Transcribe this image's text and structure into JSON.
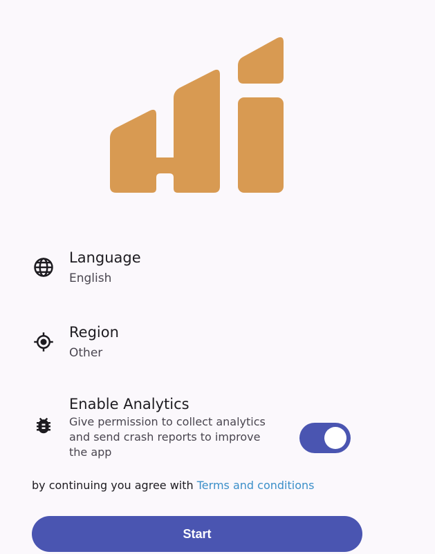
{
  "colors": {
    "background": "#fbf8fc",
    "logo": "#d89a52",
    "accent": "#4a55b1",
    "link": "#3b8fc9"
  },
  "logo": {
    "icon": "hi-logo"
  },
  "settings": {
    "language": {
      "icon": "globe-icon",
      "title": "Language",
      "value": "English"
    },
    "region": {
      "icon": "location-target-icon",
      "title": "Region",
      "value": "Other"
    },
    "analytics": {
      "icon": "bug-icon",
      "title": "Enable Analytics",
      "description": "Give permission to collect analytics and send crash reports to improve the app",
      "enabled": true
    }
  },
  "terms": {
    "prefix": "by continuing you agree with ",
    "link": "Terms and conditions"
  },
  "start_label": "Start"
}
